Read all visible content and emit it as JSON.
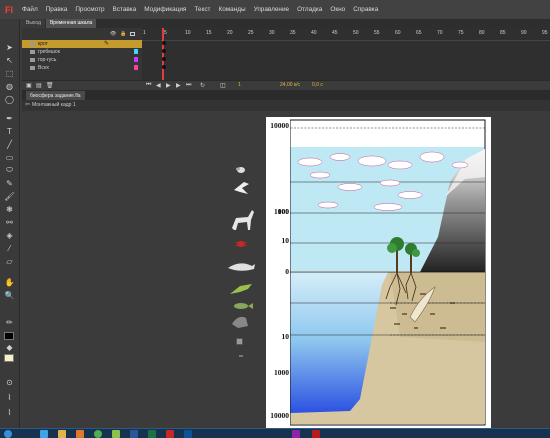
{
  "app": {
    "logo": "Fl"
  },
  "menu": [
    "Файл",
    "Правка",
    "Просмотр",
    "Вставка",
    "Модификация",
    "Текст",
    "Команды",
    "Управление",
    "Отладка",
    "Окно",
    "Справка"
  ],
  "panel_tabs": [
    "Выход",
    "Временная шкала"
  ],
  "timeline": {
    "layers": [
      {
        "name": "крот",
        "selected": true
      },
      {
        "name": "гребешок",
        "selected": false
      },
      {
        "name": "гор-гусь",
        "selected": false
      },
      {
        "name": "Всех",
        "selected": false
      }
    ],
    "frame_numbers": [
      "1",
      "5",
      "10",
      "15",
      "20",
      "25",
      "30",
      "35",
      "40",
      "45",
      "50",
      "55",
      "60",
      "65",
      "70",
      "75",
      "80",
      "85",
      "90",
      "95"
    ],
    "current_frame": "1",
    "fps": "24,00 к/с",
    "time": "0,0 с"
  },
  "document": {
    "tab": "биосфера задание.fla",
    "scene": "Монтажный кадр 1"
  },
  "artboard": {
    "y_labels": [
      "10000",
      "1000",
      "100",
      "10",
      "0",
      "10",
      "1000",
      "10000"
    ],
    "colors": {
      "sky": "#bfe8f5",
      "sea_top": "#c9e9f6",
      "sea_deep": "#1f4fe0",
      "ground": "#d8c9a2",
      "ground_dark": "#b7a47a",
      "mountain": "#7a7a7a"
    }
  },
  "taskbar_icons": [
    "start-icon",
    "ie-icon",
    "explorer-icon",
    "media-icon",
    "chrome-icon",
    "app-icon",
    "word-icon",
    "excel-icon",
    "flash-icon",
    "photoshop-icon",
    "paint-icon",
    "task-icon"
  ]
}
